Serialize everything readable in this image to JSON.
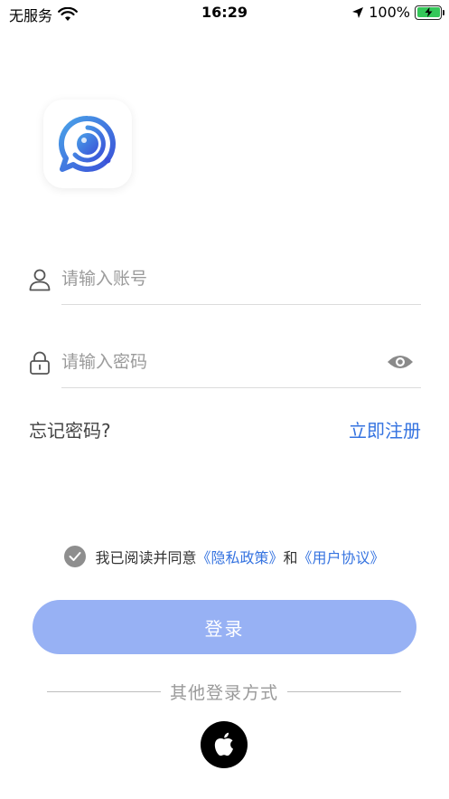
{
  "status_bar": {
    "carrier": "无服务",
    "time": "16:29",
    "battery": "100%"
  },
  "login_form": {
    "account_placeholder": "请输入账号",
    "password_placeholder": "请输入密码",
    "forgot_password": "忘记密码?",
    "register": "立即注册"
  },
  "agreement": {
    "prefix": "我已阅读并同意",
    "privacy_policy": "《隐私政策》",
    "and": "和",
    "user_agreement": "《用户协议》"
  },
  "login_button": "登录",
  "other_login": {
    "label": "其他登录方式",
    "apple_icon": "apple-icon"
  },
  "colors": {
    "accent": "#3573e0",
    "button": "#97b1f4"
  }
}
